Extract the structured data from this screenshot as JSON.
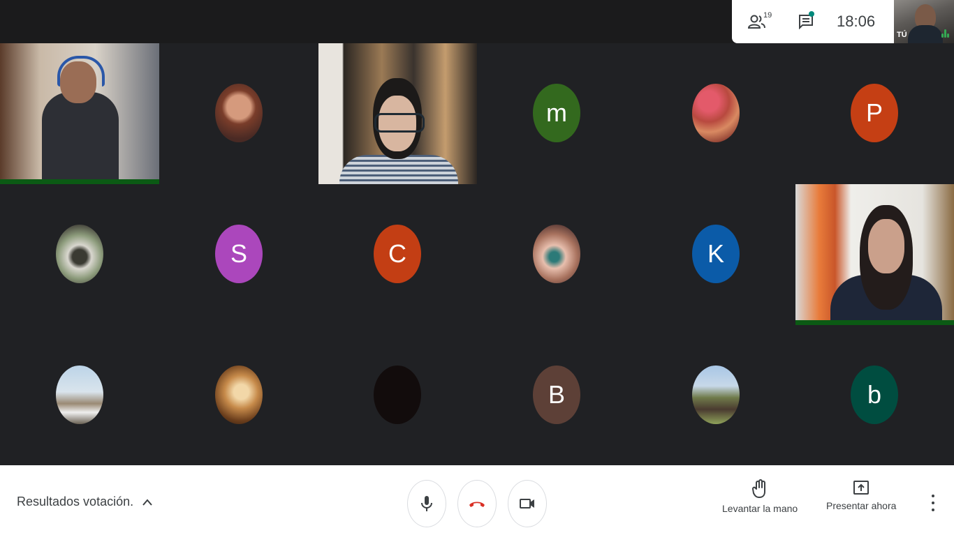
{
  "topbar": {
    "participant_count": "19",
    "clock": "18:06",
    "self_label": "TÚ"
  },
  "grid": {
    "tiles": [
      {
        "id": "video-1",
        "type": "video"
      },
      {
        "id": "avatar-photo-1",
        "type": "photo"
      },
      {
        "id": "video-2",
        "type": "video"
      },
      {
        "id": "avatar-m",
        "type": "initial",
        "initial": "m",
        "color": "#33691e"
      },
      {
        "id": "avatar-photo-2",
        "type": "photo"
      },
      {
        "id": "avatar-p",
        "type": "initial",
        "initial": "P",
        "color": "#c53f14"
      },
      {
        "id": "avatar-photo-3",
        "type": "photo"
      },
      {
        "id": "avatar-s",
        "type": "initial",
        "initial": "S",
        "color": "#ab47bc"
      },
      {
        "id": "avatar-c",
        "type": "initial",
        "initial": "C",
        "color": "#c33e14"
      },
      {
        "id": "avatar-photo-4",
        "type": "photo"
      },
      {
        "id": "avatar-k",
        "type": "initial",
        "initial": "K",
        "color": "#0b5ba8"
      },
      {
        "id": "video-3",
        "type": "video"
      },
      {
        "id": "avatar-photo-5",
        "type": "photo"
      },
      {
        "id": "avatar-photo-6",
        "type": "photo"
      },
      {
        "id": "avatar-photo-7",
        "type": "photo"
      },
      {
        "id": "avatar-b-upper",
        "type": "initial",
        "initial": "B",
        "color": "#5d4037"
      },
      {
        "id": "avatar-photo-8",
        "type": "photo"
      },
      {
        "id": "avatar-b-lower",
        "type": "initial",
        "initial": "b",
        "color": "#004d40"
      }
    ]
  },
  "bottombar": {
    "meeting_title": "Resultados votación.",
    "raise_hand_label": "Levantar la mano",
    "present_label": "Presentar ahora"
  },
  "colors": {
    "background": "#202124",
    "speaking": "#0b5a14",
    "end_call": "#d93025"
  },
  "icons": [
    "people-icon",
    "chat-icon",
    "mic-icon",
    "end-call-icon",
    "camera-icon",
    "hand-icon",
    "present-icon",
    "more-vert-icon",
    "chevron-up-icon"
  ]
}
